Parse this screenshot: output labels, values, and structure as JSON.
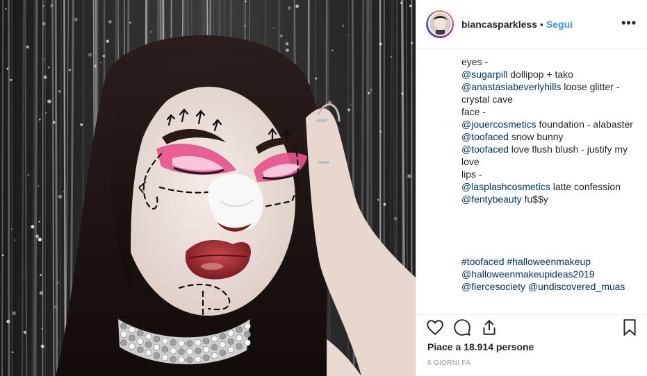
{
  "post": {
    "username": "biancasparkless",
    "separator": "•",
    "follow_label": "Segui",
    "more_label": "•••",
    "photo_alt": "Halloween makeup portrait",
    "caption": [
      {
        "text": "eyes -"
      },
      {
        "tag": "@sugarpill",
        "text": " dollipop + tako"
      },
      {
        "tag": "@anastasiabeverlyhills",
        "text": " loose glitter - crystal cave"
      },
      {
        "text": "face -"
      },
      {
        "tag": "@jouercosmetics",
        "text": " foundation - alabaster"
      },
      {
        "tag": "@toofaced",
        "text": " snow bunny"
      },
      {
        "tag": "@toofaced",
        "text": " love flush blush - justify my love"
      },
      {
        "text": "lips -"
      },
      {
        "tag": "@lasplashcosmetics",
        "text": " latte confession"
      },
      {
        "tag": "@fentybeauty",
        "text": " fu$$y"
      }
    ],
    "hashtags": {
      "line1_a": "#toofaced",
      "line1_b": "#halloweenmakeup",
      "line2": "@halloweenmakeupideas2019",
      "line3_a": "@fiercesociety",
      "line3_b": "@undiscovered_muas"
    },
    "likes_prefix": "Piace a",
    "likes_count": "18.914",
    "likes_suffix": "persone",
    "timestamp": "6 GIORNI FA"
  },
  "icons": {
    "like": "heart-icon",
    "comment": "comment-bubble-icon",
    "share": "share-icon",
    "save": "bookmark-icon",
    "more": "more-options-icon"
  },
  "colors": {
    "link": "#003569",
    "follow": "#3897f0",
    "text": "#262626",
    "muted": "#999999",
    "divider": "#efefef"
  }
}
